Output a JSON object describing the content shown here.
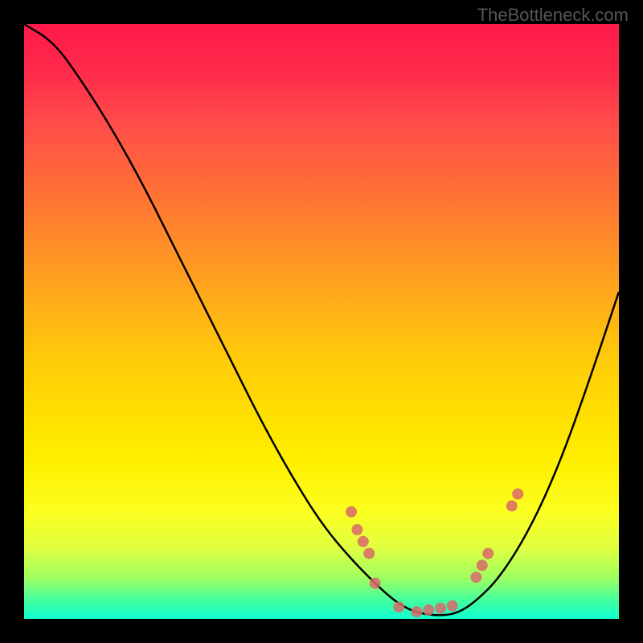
{
  "watermark": "TheBottleneck.com",
  "chart_data": {
    "type": "line",
    "title": "",
    "xlabel": "",
    "ylabel": "",
    "xlim": [
      0,
      100
    ],
    "ylim": [
      0,
      100
    ],
    "series": [
      {
        "name": "curve",
        "x": [
          0,
          5,
          10,
          15,
          20,
          25,
          30,
          35,
          40,
          45,
          50,
          55,
          60,
          63,
          66,
          70,
          73,
          76,
          80,
          85,
          90,
          95,
          100
        ],
        "y": [
          100,
          97,
          90,
          82,
          73,
          63,
          53,
          43,
          33,
          24,
          16,
          10,
          5,
          2.5,
          1,
          0.5,
          1,
          3,
          7,
          15,
          26,
          40,
          55
        ]
      }
    ],
    "markers": [
      {
        "x": 55,
        "y": 18
      },
      {
        "x": 56,
        "y": 15
      },
      {
        "x": 57,
        "y": 13
      },
      {
        "x": 58,
        "y": 11
      },
      {
        "x": 59,
        "y": 6
      },
      {
        "x": 63,
        "y": 2
      },
      {
        "x": 66,
        "y": 1.2
      },
      {
        "x": 68,
        "y": 1.5
      },
      {
        "x": 70,
        "y": 1.8
      },
      {
        "x": 72,
        "y": 2.2
      },
      {
        "x": 76,
        "y": 7
      },
      {
        "x": 77,
        "y": 9
      },
      {
        "x": 78,
        "y": 11
      },
      {
        "x": 82,
        "y": 19
      },
      {
        "x": 83,
        "y": 21
      }
    ],
    "colors": {
      "gradient_top": "#ff1a4a",
      "gradient_bottom": "#10ffd0",
      "curve": "#000000",
      "markers": "#d86a6a"
    }
  }
}
